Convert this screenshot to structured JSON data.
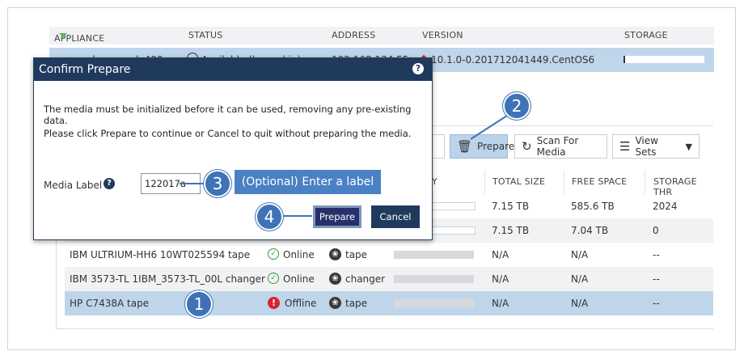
{
  "appliance_table": {
    "headers": [
      "APPLIANCE",
      "STATUS",
      "ADDRESS",
      "VERSION",
      "STORAGE"
    ],
    "row": {
      "appliance": "ne-hermes-de490",
      "status": "Available (logged in)",
      "address": "192.168.134.55",
      "version": "10.1.0-0.201712041449.CentOS6"
    }
  },
  "toolbar": {
    "partial_label": "le",
    "prepare_label": "Prepare",
    "scan_label": "Scan For Media",
    "viewsets_label": "View Sets"
  },
  "media_table": {
    "headers": [
      "Y",
      "TOTAL SIZE",
      "FREE SPACE",
      "STORAGE THR"
    ],
    "rows": [
      {
        "name": "",
        "status": "",
        "type": "",
        "total": "7.15 TB",
        "free": "585.6 TB",
        "storage": "2024"
      },
      {
        "name": "",
        "status": "",
        "type": "",
        "total": "7.15 TB",
        "free": "7.04 TB",
        "storage": "0"
      },
      {
        "name": "IBM ULTRIUM-HH6 10WT025594 tape",
        "status": "Online",
        "type": "tape",
        "total": "N/A",
        "free": "N/A",
        "storage": "--"
      },
      {
        "name": "IBM 3573-TL 1IBM_3573-TL_00L changer",
        "status": "Online",
        "type": "changer",
        "total": "N/A",
        "free": "N/A",
        "storage": "--"
      },
      {
        "name": "HP C7438A tape",
        "status": "Offline",
        "type": "tape",
        "total": "N/A",
        "free": "N/A",
        "storage": "--"
      }
    ]
  },
  "dialog": {
    "title": "Confirm Prepare",
    "line1": "The media must be initialized before it can be used, removing any pre-existing data.",
    "line2": "Please click Prepare to continue or Cancel to quit without preparing the media.",
    "media_label": "Media Label",
    "media_value": "122017a",
    "prepare_label": "Prepare",
    "cancel_label": "Cancel"
  },
  "callouts": {
    "c1": "1",
    "c2": "2",
    "c3": "3",
    "c4": "4",
    "optional_text": "(Optional) Enter a label"
  },
  "colors": {
    "accent": "#3f73b6",
    "dialog_header": "#1f3a5c",
    "selected_row": "#bfd6ea",
    "online": "#2e9b3e",
    "offline": "#d9232e"
  }
}
